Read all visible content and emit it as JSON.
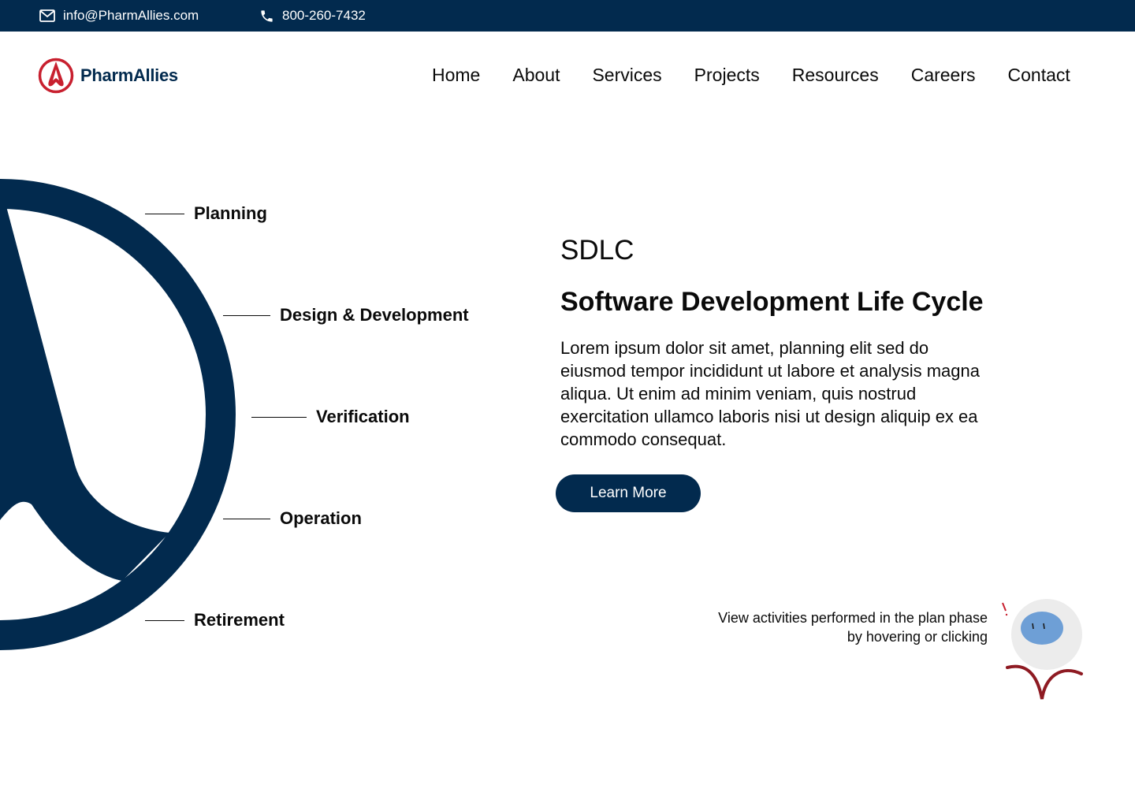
{
  "topbar": {
    "email": "info@PharmAllies.com",
    "phone": "800-260-7432"
  },
  "brand": {
    "name": "PharmAllies",
    "primary_color": "#022a4e",
    "accent_color": "#c8202f"
  },
  "nav": {
    "items": [
      "Home",
      "About",
      "Services",
      "Projects",
      "Resources",
      "Careers",
      "Contact"
    ]
  },
  "phases": {
    "planning": "Planning",
    "design": "Design & Development",
    "verification": "Verification",
    "operation": "Operation",
    "retirement": "Retirement"
  },
  "hero": {
    "kicker": "SDLC",
    "title": "Software Development Life Cycle",
    "body": "Lorem ipsum dolor sit amet, planning elit sed do eiusmod tempor incididunt ut labore et analysis magna aliqua. Ut enim ad minim veniam, quis nostrud exercitation ullamco laboris nisi ut design aliquip ex ea commodo consequat.",
    "cta": "Learn More"
  },
  "hint": {
    "text": "View activities performed in the plan phase by  hovering or clicking"
  },
  "icons": {
    "email": "mail-icon",
    "phone": "phone-icon",
    "logo": "pharmallies-logo-icon",
    "mascot": "mascot-icon"
  }
}
